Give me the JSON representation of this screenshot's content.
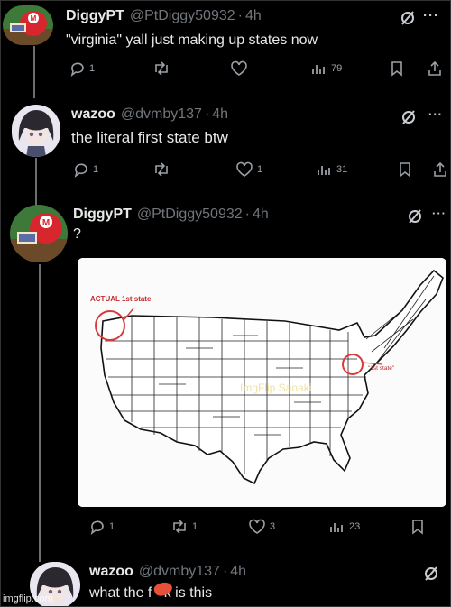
{
  "posts": [
    {
      "name": "DiggyPT",
      "handle": "@PtDiggy50932",
      "time": "4h",
      "text": "\"virginia\" yall just making up states now",
      "replies": "1",
      "retweets": "",
      "likes": "",
      "views": "79"
    },
    {
      "name": "wazoo",
      "handle": "@dvmby137",
      "time": "4h",
      "text": "the literal first state btw",
      "replies": "1",
      "retweets": "",
      "likes": "1",
      "views": "31"
    },
    {
      "name": "DiggyPT",
      "handle": "@PtDiggy50932",
      "time": "4h",
      "text": "?",
      "replies": "1",
      "retweets": "1",
      "likes": "3",
      "views": "23",
      "image": {
        "label_actual": "ACTUAL 1st state",
        "label_first": "\"1st state\"",
        "label_mark": "ImgFlip Sanaki"
      }
    },
    {
      "name": "wazoo",
      "handle": "@dvmby137",
      "time": "4h",
      "text_before": "what the f",
      "text_after": "k is this"
    }
  ],
  "separator": "·",
  "more": "···",
  "watermark": "imgflip.com",
  "colors": {
    "background": "#000000",
    "text": "#e7e9ea",
    "muted": "#71767b",
    "map_circle": "#d63b3b"
  }
}
